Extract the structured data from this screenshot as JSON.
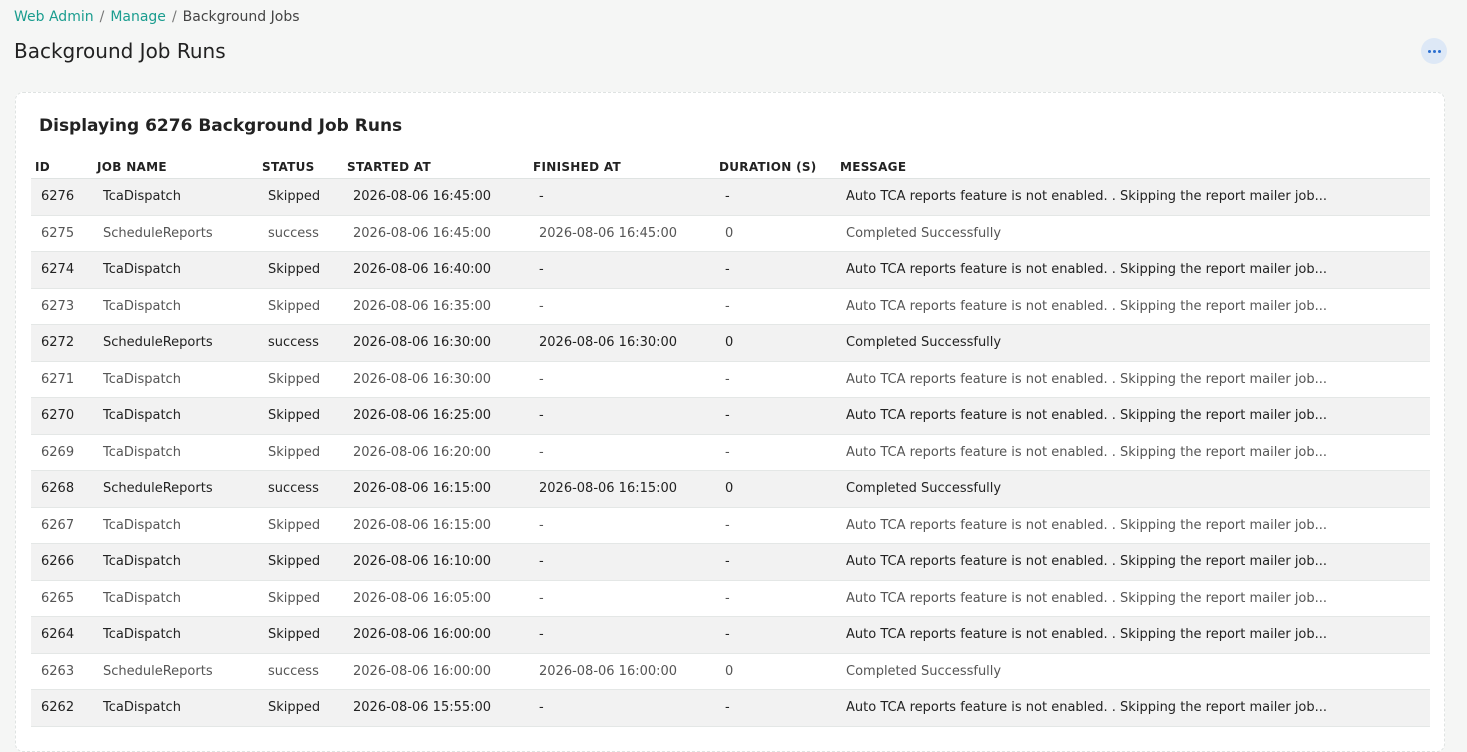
{
  "breadcrumb": {
    "items": [
      "Web Admin",
      "Manage"
    ],
    "separator": "/",
    "current": "Background Jobs"
  },
  "page": {
    "title": "Background Job Runs",
    "more_icon": "ellipsis-horizontal-icon"
  },
  "card": {
    "title": "Displaying 6276 Background Job Runs"
  },
  "colors": {
    "link": "#1a9d8f",
    "more_button_bg": "#dde8f6",
    "more_button_dots": "#2b6fd0",
    "row_stripe": "#f2f2f2"
  },
  "table": {
    "columns": [
      "ID",
      "JOB NAME",
      "STATUS",
      "STARTED AT",
      "FINISHED AT",
      "DURATION (S)",
      "MESSAGE"
    ],
    "rows": [
      [
        "6276",
        "TcaDispatch",
        "Skipped",
        "2026-08-06 16:45:00",
        "-",
        "-",
        "Auto TCA reports feature is not enabled. . Skipping the report mailer job..."
      ],
      [
        "6275",
        "ScheduleReports",
        "success",
        "2026-08-06 16:45:00",
        "2026-08-06 16:45:00",
        "0",
        "Completed Successfully"
      ],
      [
        "6274",
        "TcaDispatch",
        "Skipped",
        "2026-08-06 16:40:00",
        "-",
        "-",
        "Auto TCA reports feature is not enabled. . Skipping the report mailer job..."
      ],
      [
        "6273",
        "TcaDispatch",
        "Skipped",
        "2026-08-06 16:35:00",
        "-",
        "-",
        "Auto TCA reports feature is not enabled. . Skipping the report mailer job..."
      ],
      [
        "6272",
        "ScheduleReports",
        "success",
        "2026-08-06 16:30:00",
        "2026-08-06 16:30:00",
        "0",
        "Completed Successfully"
      ],
      [
        "6271",
        "TcaDispatch",
        "Skipped",
        "2026-08-06 16:30:00",
        "-",
        "-",
        "Auto TCA reports feature is not enabled. . Skipping the report mailer job..."
      ],
      [
        "6270",
        "TcaDispatch",
        "Skipped",
        "2026-08-06 16:25:00",
        "-",
        "-",
        "Auto TCA reports feature is not enabled. . Skipping the report mailer job..."
      ],
      [
        "6269",
        "TcaDispatch",
        "Skipped",
        "2026-08-06 16:20:00",
        "-",
        "-",
        "Auto TCA reports feature is not enabled. . Skipping the report mailer job..."
      ],
      [
        "6268",
        "ScheduleReports",
        "success",
        "2026-08-06 16:15:00",
        "2026-08-06 16:15:00",
        "0",
        "Completed Successfully"
      ],
      [
        "6267",
        "TcaDispatch",
        "Skipped",
        "2026-08-06 16:15:00",
        "-",
        "-",
        "Auto TCA reports feature is not enabled. . Skipping the report mailer job..."
      ],
      [
        "6266",
        "TcaDispatch",
        "Skipped",
        "2026-08-06 16:10:00",
        "-",
        "-",
        "Auto TCA reports feature is not enabled. . Skipping the report mailer job..."
      ],
      [
        "6265",
        "TcaDispatch",
        "Skipped",
        "2026-08-06 16:05:00",
        "-",
        "-",
        "Auto TCA reports feature is not enabled. . Skipping the report mailer job..."
      ],
      [
        "6264",
        "TcaDispatch",
        "Skipped",
        "2026-08-06 16:00:00",
        "-",
        "-",
        "Auto TCA reports feature is not enabled. . Skipping the report mailer job..."
      ],
      [
        "6263",
        "ScheduleReports",
        "success",
        "2026-08-06 16:00:00",
        "2026-08-06 16:00:00",
        "0",
        "Completed Successfully"
      ],
      [
        "6262",
        "TcaDispatch",
        "Skipped",
        "2026-08-06 15:55:00",
        "-",
        "-",
        "Auto TCA reports feature is not enabled. . Skipping the report mailer job..."
      ]
    ]
  }
}
